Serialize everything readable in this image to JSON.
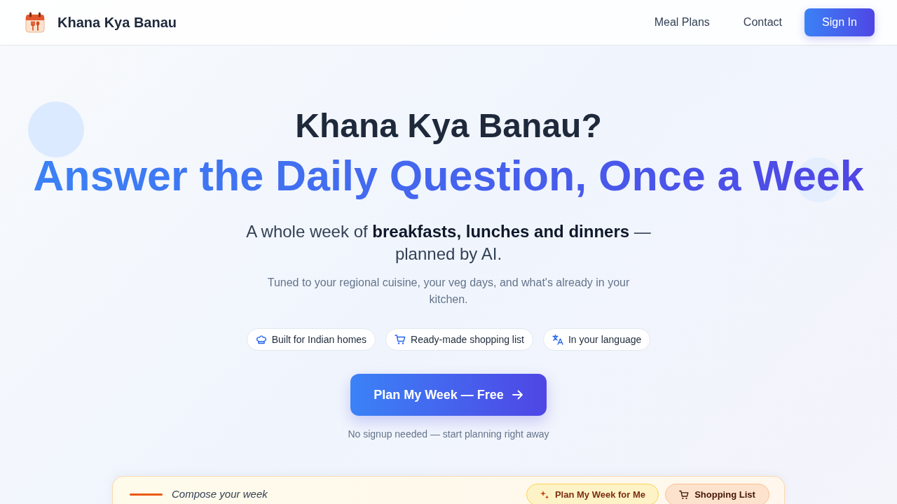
{
  "navbar": {
    "brand": "Khana Kya Banau",
    "links": [
      {
        "label": "Meal Plans"
      },
      {
        "label": "Contact"
      }
    ],
    "sign_in": "Sign In"
  },
  "hero": {
    "title": "Khana Kya Banau?",
    "headline": "Answer the Daily Question, Once a Week",
    "subtitle": "A whole week of **breakfasts, lunches and dinners** — planned by AI.",
    "description": "Tuned to your regional cuisine, your veg days, and what's already in your kitchen.",
    "features": [
      {
        "label": "Built for Indian homes"
      },
      {
        "label": "Ready-made shopping list"
      },
      {
        "label": "In your language"
      }
    ],
    "cta": "Plan My Week — Free",
    "note": "No signup needed — start planning right away"
  },
  "composer": {
    "title": "Compose your week",
    "actions": [
      {
        "label": "Plan My Week for Me"
      },
      {
        "label": "Shopping List"
      }
    ]
  }
}
